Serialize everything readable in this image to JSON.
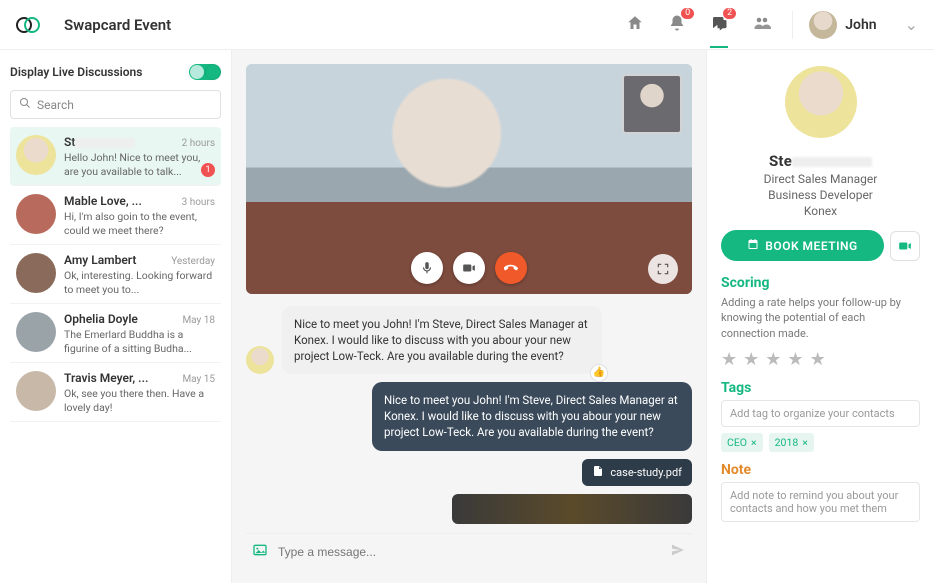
{
  "header": {
    "app_title": "Swapcard Event",
    "badges": {
      "bell": "0",
      "chat": "2"
    },
    "user_name": "John"
  },
  "sidebar": {
    "toggle_label": "Display Live Discussions",
    "search_placeholder": "Search",
    "conversations": [
      {
        "name": "St",
        "time": "2 hours",
        "preview": "Hello John! Nice to meet you, are you available to talk...",
        "unread": "1",
        "active": true
      },
      {
        "name": "Mable Love, ...",
        "time": "3 hours",
        "preview": "Hi, I'm also goin to the event, could we meet there?"
      },
      {
        "name": "Amy Lambert",
        "time": "Yesterday",
        "preview": "Ok, interesting. Looking forward to meet you to..."
      },
      {
        "name": "Ophelia Doyle",
        "time": "May 18",
        "preview": "The Emerlard Buddha is a figurine of a sitting Budha..."
      },
      {
        "name": "Travis Meyer, ...",
        "time": "May 15",
        "preview": "Ok, see you there then. Have a lovely day!"
      }
    ]
  },
  "chat": {
    "msg_in": "Nice to meet you John! I'm Steve, Direct Sales Manager at Konex. I would like to discuss with you abour your new project Low-Teck. Are you available during the event?",
    "msg_out": "Nice to meet you John! I'm Steve, Direct Sales Manager at Konex. I would like to discuss with you abour your new project Low-Teck. Are you available during the event?",
    "attachment": "case-study.pdf",
    "compose_placeholder": "Type a message..."
  },
  "profile": {
    "name_prefix": "Ste",
    "role1": "Direct Sales Manager",
    "role2": "Business Developer",
    "company": "Konex",
    "book_label": "BOOK MEETING",
    "scoring_title": "Scoring",
    "scoring_desc": "Adding a rate helps your follow-up by knowing the potential of each connection made.",
    "tags_title": "Tags",
    "tags_placeholder": "Add tag to organize your contacts",
    "tags": [
      "CEO",
      "2018"
    ],
    "note_title": "Note",
    "note_placeholder": "Add note to remind you about your contacts and how you met them"
  }
}
